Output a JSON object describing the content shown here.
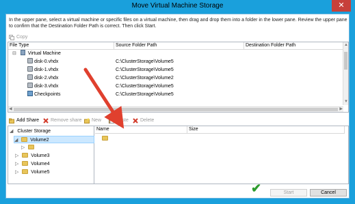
{
  "window": {
    "title": "Move Virtual Machine Storage",
    "close_glyph": "✕"
  },
  "instructions": "In the upper pane, select a virtual machine or specific files on a virtual machine, then drag and drop them into a folder in the lower pane.  Review the upper pane to confirm that the Destination Folder Path is correct. Then click Start.",
  "upper_toolbar": {
    "copy_label": "Copy"
  },
  "upper_table": {
    "columns": [
      "File Type",
      "Source Folder Path",
      "Destination Folder Path"
    ],
    "root": {
      "expander": "⊟",
      "label": "Virtual Machine"
    },
    "rows": [
      {
        "name": "disk-0.vhdx",
        "source": "C:\\ClusterStorage\\Volume5",
        "dest": ""
      },
      {
        "name": "disk-1.vhdx",
        "source": "C:\\ClusterStorage\\Volume5",
        "dest": ""
      },
      {
        "name": "disk-2.vhdx",
        "source": "C:\\ClusterStorage\\Volume2",
        "dest": ""
      },
      {
        "name": "disk-3.vhdx",
        "source": "C:\\ClusterStorage\\Volume5",
        "dest": ""
      },
      {
        "name": "Checkpoints",
        "source": "C:\\ClusterStorage\\Volume5",
        "dest": ""
      }
    ]
  },
  "lower_toolbar": {
    "add_share": "Add Share",
    "remove_share": "Remove share",
    "new": "New",
    "paste": "Paste",
    "delete": "Delete"
  },
  "tree": {
    "root": "Cluster Storage",
    "items": [
      {
        "label": "Volume2",
        "expander": "◢",
        "selected": true
      },
      {
        "label": "",
        "expander": "▷",
        "selected": false
      },
      {
        "label": "Volume3",
        "expander": "▷",
        "selected": false
      },
      {
        "label": "Volume4",
        "expander": "▷",
        "selected": false
      },
      {
        "label": "Volume5",
        "expander": "▷",
        "selected": false
      }
    ]
  },
  "list": {
    "columns": [
      "Name",
      "Size"
    ]
  },
  "footer": {
    "start": "Start",
    "cancel": "Cancel"
  },
  "colors": {
    "annotation_arrow": "#e0402e",
    "checkmark": "#2c9b2c",
    "titlebar": "#1aa0dc",
    "close_button": "#c7403a"
  },
  "icons": [
    "folder-icon",
    "virtual-machine-icon",
    "disk-icon",
    "checkpoints-icon",
    "copy-icon",
    "add-share-icon",
    "remove-share-icon",
    "new-folder-icon",
    "paste-icon",
    "delete-icon",
    "close-icon",
    "checkmark-icon"
  ]
}
